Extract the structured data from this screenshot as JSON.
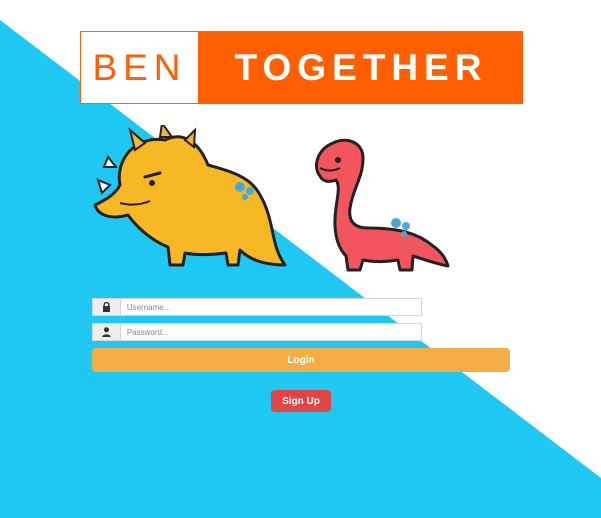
{
  "logo": {
    "left_text": "BEN",
    "right_text": "TOGETHER"
  },
  "login_form": {
    "username_placeholder": "Username...",
    "password_placeholder": "Password...",
    "username_icon": "lock-icon",
    "password_icon": "user-icon"
  },
  "buttons": {
    "login_label": "Login",
    "signup_label": "Sign Up"
  },
  "colors": {
    "background_blue": "#1ec8f2",
    "logo_orange": "#ff5f00",
    "login_button": "#f4ad45",
    "signup_button": "#e24445",
    "triceratops": "#f7b826",
    "brontosaurus": "#f2555e"
  }
}
